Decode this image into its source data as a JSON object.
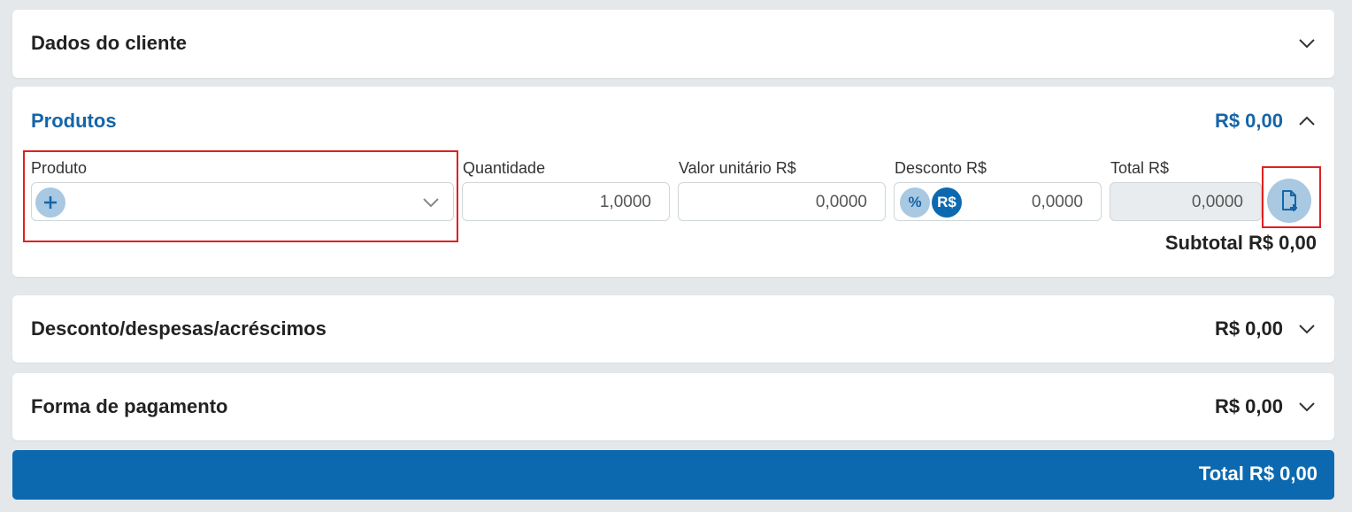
{
  "sections": {
    "cliente": {
      "title": "Dados do cliente"
    },
    "produtos": {
      "title": "Produtos",
      "amount": "R$ 0,00",
      "fields": {
        "produto": {
          "label": "Produto",
          "value": ""
        },
        "quantidade": {
          "label": "Quantidade",
          "value": "1,0000"
        },
        "valor_unitario": {
          "label": "Valor unitário R$",
          "value": "0,0000"
        },
        "desconto": {
          "label": "Desconto R$",
          "value": "0,0000",
          "percent_label": "%",
          "currency_label": "R$"
        },
        "total": {
          "label": "Total R$",
          "value": "0,0000"
        }
      },
      "subtotal": "Subtotal R$ 0,00"
    },
    "desconto": {
      "title": "Desconto/despesas/acréscimos",
      "amount": "R$ 0,00"
    },
    "pagamento": {
      "title": "Forma de pagamento",
      "amount": "R$ 0,00"
    }
  },
  "total_bar": {
    "label": "Total R$ 0,00"
  },
  "colors": {
    "accent": "#1565a8",
    "primary_bar": "#0c69b0",
    "highlight": "#e02020",
    "soft_blue": "#a9c8e1"
  }
}
